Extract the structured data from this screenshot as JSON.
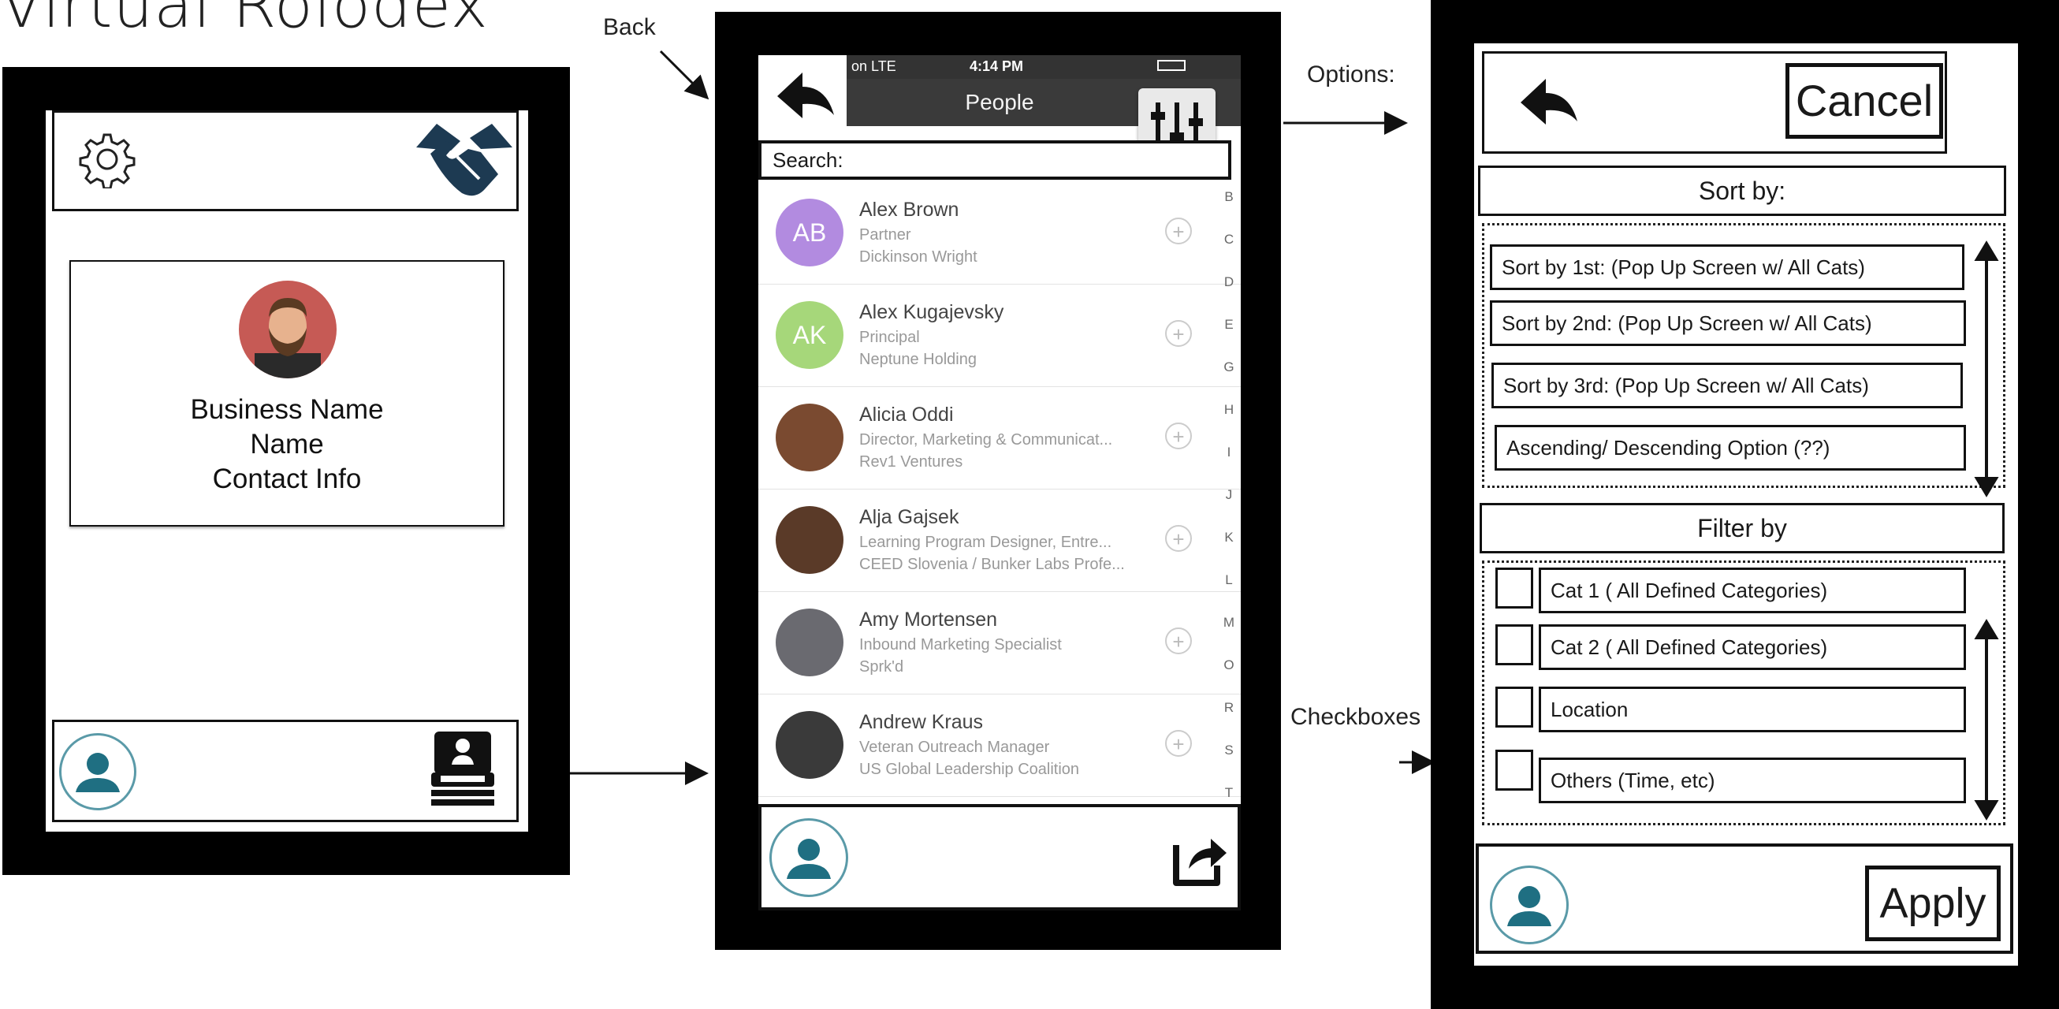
{
  "page_title": "Virtual Rolodex",
  "annotations": {
    "back": "Back",
    "options": "Options:",
    "checkboxes": "Checkboxes"
  },
  "home_screen": {
    "card": {
      "line1": "Business Name",
      "line2": "Name",
      "line3": "Contact Info"
    },
    "icons": [
      "gear-icon",
      "handshake-icon",
      "profile-icon",
      "rolodex-icon"
    ]
  },
  "people_screen": {
    "status": {
      "carrier": "on  LTE",
      "time": "4:14 PM"
    },
    "nav_title": "People",
    "search_label": "Search:",
    "people": [
      {
        "initials": "AB",
        "color": "#b28be0",
        "name": "Alex Brown",
        "role": "Partner",
        "org": "Dickinson Wright"
      },
      {
        "initials": "AK",
        "color": "#a6d77a",
        "name": "Alex Kugajevsky",
        "role": "Principal",
        "org": "Neptune Holding"
      },
      {
        "initials": "",
        "color": "#7a4a30",
        "name": "Alicia Oddi",
        "role": "Director, Marketing & Communicat...",
        "org": "Rev1 Ventures"
      },
      {
        "initials": "",
        "color": "#5a3a28",
        "name": "Alja Gajsek",
        "role": "Learning Program Designer, Entre...",
        "org": "CEED Slovenia / Bunker Labs Profe..."
      },
      {
        "initials": "",
        "color": "#6a6a70",
        "name": "Amy Mortensen",
        "role": "Inbound Marketing Specialist",
        "org": "Sprk'd"
      },
      {
        "initials": "",
        "color": "#3a3a3a",
        "name": "Andrew Kraus",
        "role": "Veteran Outreach Manager",
        "org": "US Global Leadership Coalition"
      }
    ],
    "index_letters": [
      "B",
      "C",
      "D",
      "E",
      "G",
      "H",
      "I",
      "J",
      "K",
      "L",
      "M",
      "O",
      "R",
      "S",
      "T"
    ]
  },
  "options_screen": {
    "cancel_label": "Cancel",
    "sort_header": "Sort by:",
    "sort_options": [
      "Sort by 1st: (Pop Up Screen w/ All Cats)",
      "Sort by 2nd: (Pop Up Screen w/ All Cats)",
      "Sort by 3rd: (Pop Up Screen w/ All Cats)",
      "Ascending/ Descending Option (??)"
    ],
    "filter_header": "Filter by",
    "filter_options": [
      "Cat 1 ( All Defined Categories)",
      "Cat 2 ( All Defined Categories)",
      "Location",
      "Others (Time, etc)"
    ],
    "apply_label": "Apply"
  },
  "colors": {
    "profile_teal": "#1f6f82",
    "frame": "#000000"
  }
}
